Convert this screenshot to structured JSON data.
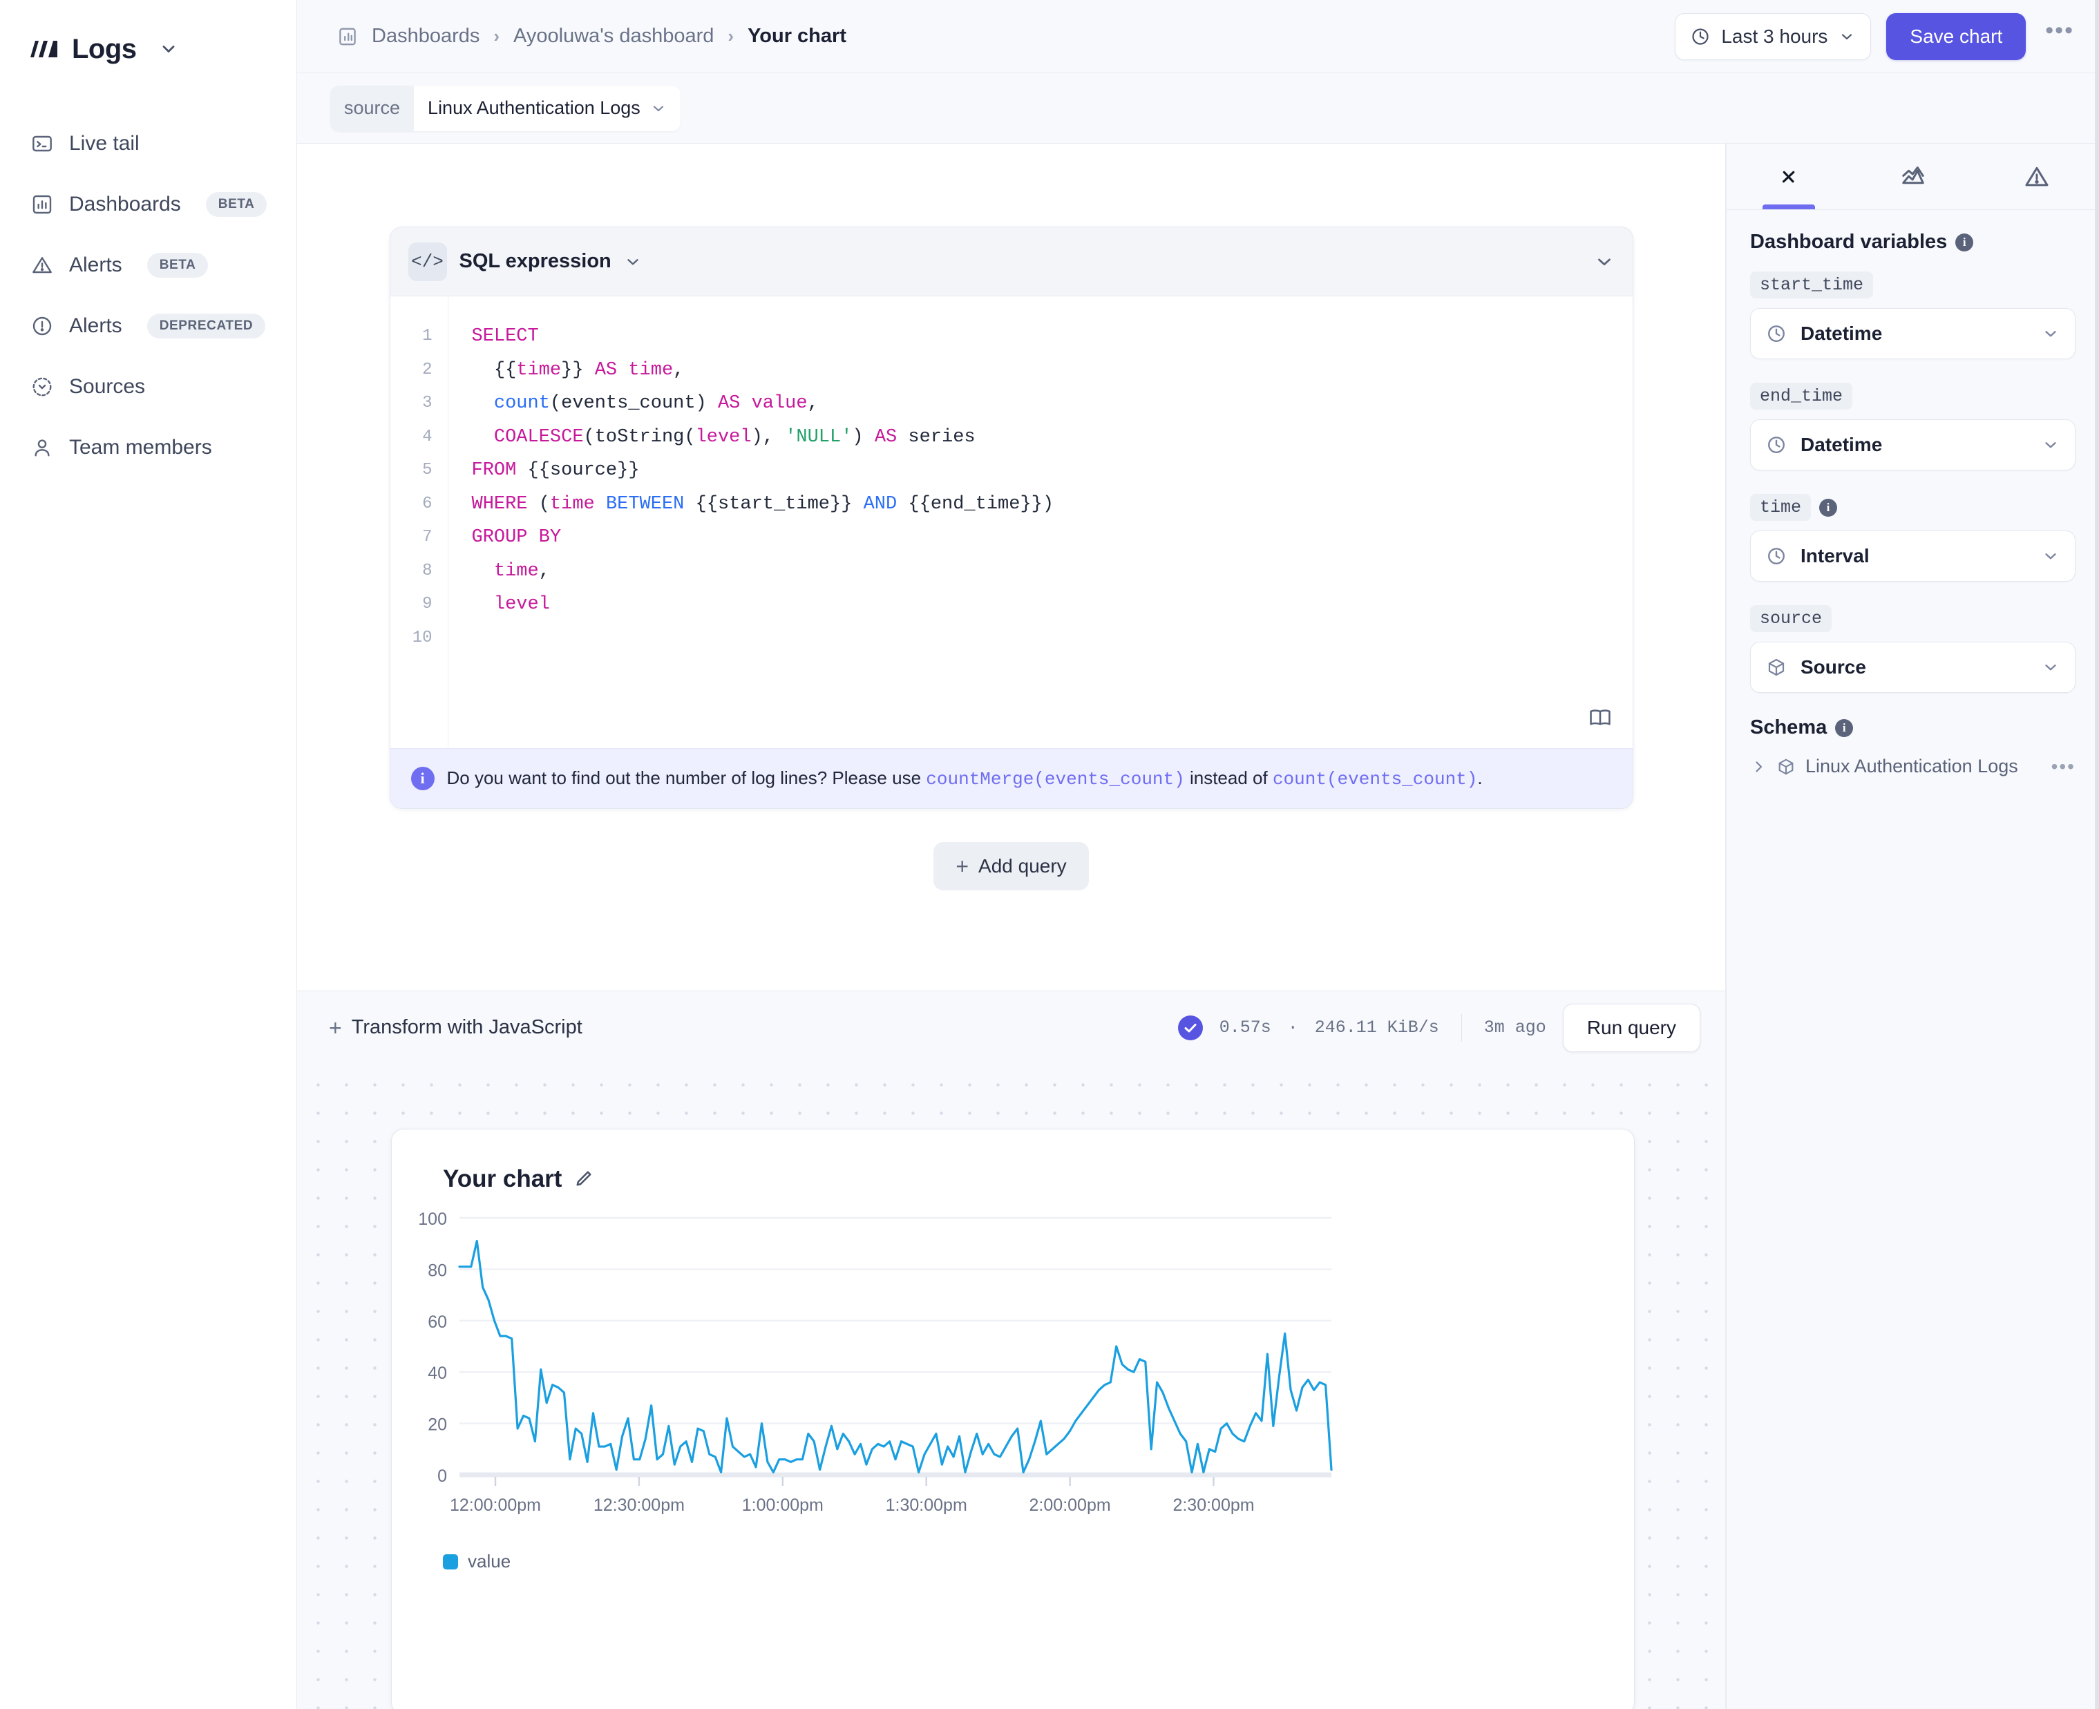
{
  "brand": {
    "name": "Logs",
    "logo_icon": "logs-logo-icon",
    "chevron_icon": "chevron-down-icon"
  },
  "sidebar": {
    "items": [
      {
        "label": "Live tail",
        "icon": "terminal-icon",
        "badge": ""
      },
      {
        "label": "Dashboards",
        "icon": "bar-chart-icon",
        "badge": "BETA"
      },
      {
        "label": "Alerts",
        "icon": "warning-triangle-icon",
        "badge": "BETA"
      },
      {
        "label": "Alerts",
        "icon": "alert-circle-icon",
        "badge": "DEPRECATED"
      },
      {
        "label": "Sources",
        "icon": "sources-icon",
        "badge": ""
      },
      {
        "label": "Team members",
        "icon": "user-icon",
        "badge": ""
      }
    ]
  },
  "topbar": {
    "breadcrumb": [
      {
        "label": "Dashboards",
        "active": false
      },
      {
        "label": "Ayooluwa's dashboard",
        "active": false
      },
      {
        "label": "Your chart",
        "active": true
      }
    ],
    "separator": "›",
    "time_range": "Last 3 hours",
    "time_icon": "clock-icon",
    "save_label": "Save chart",
    "more_label": "•••",
    "accent_color": "#5654e0"
  },
  "source_filter": {
    "key": "source",
    "value": "Linux Authentication Logs",
    "chevron_icon": "chevron-down-icon"
  },
  "query": {
    "panel_title": "SQL expression",
    "panel_icon": "code-icon",
    "collapse_icon": "chevron-down-icon",
    "docs_icon": "book-icon",
    "line_numbers": [
      "1",
      "2",
      "3",
      "4",
      "5",
      "6",
      "7",
      "8",
      "9",
      "10"
    ],
    "code_lines": [
      [
        {
          "t": "SELECT",
          "c": "kw"
        }
      ],
      [
        {
          "t": "  {{",
          "c": "pln"
        },
        {
          "t": "time",
          "c": "kw"
        },
        {
          "t": "}} ",
          "c": "pln"
        },
        {
          "t": "AS",
          "c": "kw"
        },
        {
          "t": " ",
          "c": "pln"
        },
        {
          "t": "time",
          "c": "kw"
        },
        {
          "t": ",",
          "c": "pln"
        }
      ],
      [
        {
          "t": "  ",
          "c": "pln"
        },
        {
          "t": "count",
          "c": "fn"
        },
        {
          "t": "(events_count) ",
          "c": "pln"
        },
        {
          "t": "AS",
          "c": "kw"
        },
        {
          "t": " ",
          "c": "pln"
        },
        {
          "t": "value",
          "c": "kw"
        },
        {
          "t": ",",
          "c": "pln"
        }
      ],
      [
        {
          "t": "  ",
          "c": "pln"
        },
        {
          "t": "COALESCE",
          "c": "kw"
        },
        {
          "t": "(toString(",
          "c": "pln"
        },
        {
          "t": "level",
          "c": "kw"
        },
        {
          "t": "), ",
          "c": "pln"
        },
        {
          "t": "'NULL'",
          "c": "str"
        },
        {
          "t": ") ",
          "c": "pln"
        },
        {
          "t": "AS",
          "c": "kw"
        },
        {
          "t": " series",
          "c": "pln"
        }
      ],
      [
        {
          "t": "FROM",
          "c": "kw"
        },
        {
          "t": " {{source}}",
          "c": "pln"
        }
      ],
      [
        {
          "t": "WHERE",
          "c": "kw"
        },
        {
          "t": " (",
          "c": "pln"
        },
        {
          "t": "time",
          "c": "kw"
        },
        {
          "t": " ",
          "c": "pln"
        },
        {
          "t": "BETWEEN",
          "c": "fn"
        },
        {
          "t": " {{start_time}} ",
          "c": "pln"
        },
        {
          "t": "AND",
          "c": "fn"
        },
        {
          "t": " {{end_time}})",
          "c": "pln"
        }
      ],
      [
        {
          "t": "GROUP BY",
          "c": "kw"
        }
      ],
      [
        {
          "t": "  ",
          "c": "pln"
        },
        {
          "t": "time",
          "c": "kw"
        },
        {
          "t": ",",
          "c": "pln"
        }
      ],
      [
        {
          "t": "  ",
          "c": "pln"
        },
        {
          "t": "level",
          "c": "kw"
        }
      ],
      [
        {
          "t": "",
          "c": "pln"
        }
      ]
    ],
    "note": {
      "icon": "info-icon",
      "prefix": "Do you want to find out the number of log lines? Please use ",
      "code_good": "countMerge(events_count)",
      "middle": " instead of ",
      "code_bad": "count(events_count)",
      "suffix": "."
    },
    "add_query_label": "Add query",
    "add_query_icon": "plus-icon"
  },
  "transform_bar": {
    "label": "Transform with JavaScript",
    "plus_icon": "plus-icon",
    "status_icon": "check-circle-icon",
    "duration": "0.57s",
    "dot": "·",
    "throughput": "246.11 KiB/s",
    "last_run": "3m ago",
    "run_label": "Run query"
  },
  "chart_panel": {
    "title": "Your chart",
    "edit_icon": "pencil-icon"
  },
  "right_panel": {
    "tabs": [
      {
        "icon": "variable-x-icon",
        "name": "variables",
        "active": true
      },
      {
        "icon": "chart-area-icon",
        "name": "visualization",
        "active": false
      },
      {
        "icon": "warning-triangle-icon",
        "name": "alerts",
        "active": false
      }
    ],
    "variables_heading": "Dashboard variables",
    "variables": [
      {
        "key": "start_time",
        "value": "Datetime",
        "icon": "clock-icon",
        "info": false
      },
      {
        "key": "end_time",
        "value": "Datetime",
        "icon": "clock-icon",
        "info": false
      },
      {
        "key": "time",
        "value": "Interval",
        "icon": "clock-icon",
        "info": true
      },
      {
        "key": "source",
        "value": "Source",
        "icon": "cube-icon",
        "info": false
      }
    ],
    "schema_heading": "Schema",
    "schema_items": [
      {
        "name": "Linux Authentication Logs",
        "icon": "cube-icon",
        "expand_icon": "chevron-right-icon",
        "menu": "•••"
      }
    ]
  },
  "chart_data": {
    "type": "line",
    "title": "Your chart",
    "xlabel": "",
    "ylabel": "",
    "ylim": [
      0,
      100
    ],
    "yticks": [
      0,
      20,
      40,
      60,
      80,
      100
    ],
    "xticks": [
      "12:00:00pm",
      "12:30:00pm",
      "1:00:00pm",
      "1:30:00pm",
      "2:00:00pm",
      "2:30:00pm"
    ],
    "grid": true,
    "legend": [
      "value"
    ],
    "legend_position": "bottom-left",
    "series": [
      {
        "name": "value",
        "color": "#1a9fe0",
        "values": [
          81,
          81,
          81,
          91,
          73,
          68,
          60,
          54,
          54,
          53,
          18,
          23,
          22,
          13,
          41,
          28,
          35,
          34,
          32,
          6,
          18,
          16,
          5,
          24,
          11,
          11,
          12,
          2,
          15,
          22,
          6,
          6,
          14,
          27,
          6,
          8,
          19,
          4,
          11,
          13,
          5,
          18,
          17,
          8,
          7,
          1,
          22,
          11,
          9,
          7,
          8,
          3,
          20,
          5,
          1,
          6,
          6,
          5,
          6,
          6,
          16,
          13,
          2,
          11,
          19,
          10,
          16,
          13,
          8,
          12,
          4,
          10,
          12,
          11,
          13,
          6,
          13,
          12,
          11,
          1,
          8,
          12,
          16,
          4,
          11,
          7,
          15,
          1,
          9,
          16,
          8,
          12,
          8,
          7,
          11,
          15,
          18,
          1,
          6,
          13,
          21,
          8,
          10,
          12,
          14,
          17,
          21,
          24,
          27,
          30,
          33,
          35,
          36,
          50,
          43,
          41,
          40,
          45,
          44,
          10,
          36,
          32,
          26,
          21,
          16,
          13,
          1,
          12,
          1,
          10,
          9,
          18,
          20,
          16,
          14,
          13,
          19,
          24,
          21,
          47,
          19,
          38,
          55,
          33,
          25,
          34,
          37,
          33,
          36,
          35,
          2
        ]
      }
    ]
  }
}
